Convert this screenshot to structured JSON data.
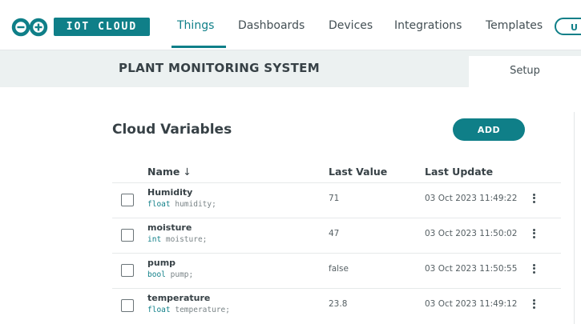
{
  "brand": {
    "name": "IOT CLOUD",
    "logo_icon": "arduino-infinity-icon",
    "accent": "#0f7f88"
  },
  "nav": {
    "items": [
      {
        "label": "Things",
        "active": true
      },
      {
        "label": "Dashboards",
        "active": false
      },
      {
        "label": "Devices",
        "active": false
      },
      {
        "label": "Integrations",
        "active": false
      },
      {
        "label": "Templates",
        "active": false
      }
    ],
    "upgrade_label_partial": "U"
  },
  "thing": {
    "title": "PLANT MONITORING SYSTEM",
    "active_tab": "Setup"
  },
  "variables": {
    "section_title": "Cloud Variables",
    "add_label": "ADD",
    "columns": {
      "name": "Name",
      "sort_icon": "down-arrow-icon",
      "last_value": "Last Value",
      "last_update": "Last Update"
    },
    "rows": [
      {
        "name": "Humidity",
        "type": "float",
        "identifier": "humidity;",
        "value": "71",
        "updated": "03 Oct 2023 11:49:22"
      },
      {
        "name": "moisture",
        "type": "int",
        "identifier": "moisture;",
        "value": "47",
        "updated": "03 Oct 2023 11:50:02"
      },
      {
        "name": "pump",
        "type": "bool",
        "identifier": "pump;",
        "value": "false",
        "updated": "03 Oct 2023 11:50:55"
      },
      {
        "name": "temperature",
        "type": "float",
        "identifier": "temperature;",
        "value": "23.8",
        "updated": "03 Oct 2023 11:49:12"
      }
    ]
  }
}
